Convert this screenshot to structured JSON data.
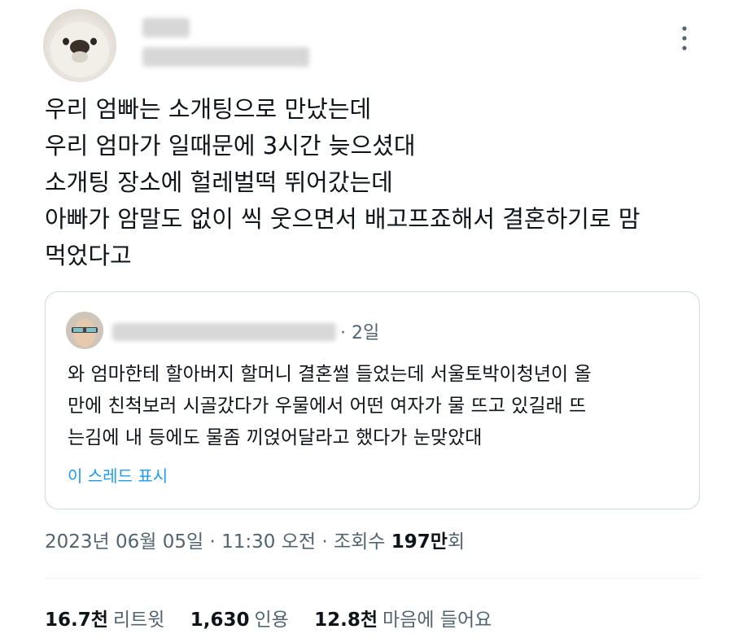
{
  "tweet": {
    "lines": [
      "우리 엄빠는 소개팅으로 만났는데",
      "우리 엄마가 일때문에 3시간 늦으셨대",
      "소개팅 장소에 헐레벌떡 뛰어갔는데",
      "아빠가 암말도 없이 씩 웃으면서 배고프죠해서 결혼하기로 맘",
      "먹었다고"
    ],
    "more_icon": "more-vertical-icon"
  },
  "quote": {
    "time": "· 2일",
    "lines": [
      "와 엄마한테 할아버지 할머니 결혼썰 들었는데 서울토박이청년이 올",
      "만에 친척보러 시골갔다가 우물에서 어떤 여자가 물 뜨고 있길래 뜨",
      "는김에 내 등에도 물좀 끼얹어달라고 했다가 눈맞았대"
    ],
    "show_thread": "이 스레드 표시"
  },
  "meta": {
    "datetime": "2023년 06월 05일 · 11:30 오전 · 조회수 ",
    "views_number": "197",
    "views_unit": "만",
    "views_suffix": "회"
  },
  "stats": [
    {
      "value": "16.7천",
      "label": "리트윗"
    },
    {
      "value": "1,630",
      "label": "인용"
    },
    {
      "value": "12.8천",
      "label": "마음에 들어요"
    }
  ],
  "colors": {
    "accent": "#1d9bf0",
    "text": "#0f1419",
    "secondary": "#536471",
    "border": "#cfd9de"
  }
}
